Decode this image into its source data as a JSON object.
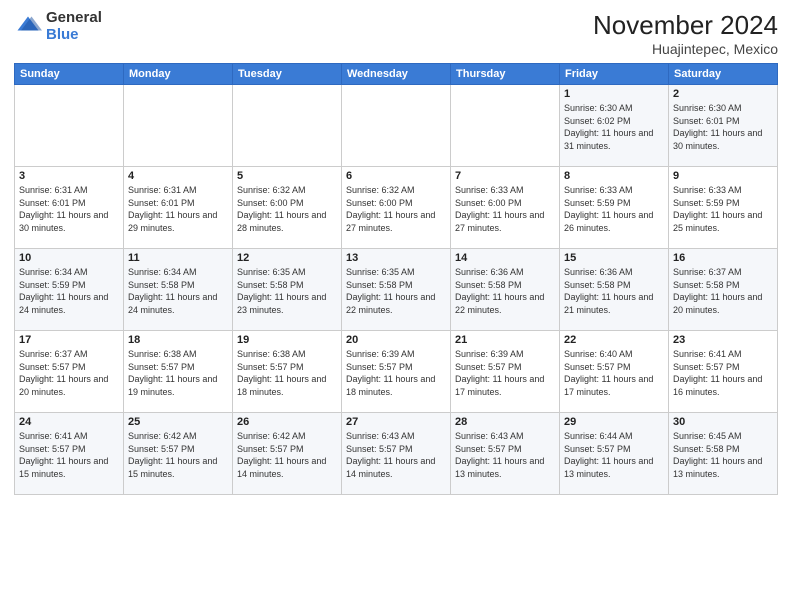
{
  "logo": {
    "general": "General",
    "blue": "Blue"
  },
  "header": {
    "month": "November 2024",
    "location": "Huajintepec, Mexico"
  },
  "days_of_week": [
    "Sunday",
    "Monday",
    "Tuesday",
    "Wednesday",
    "Thursday",
    "Friday",
    "Saturday"
  ],
  "weeks": [
    [
      {
        "day": "",
        "info": ""
      },
      {
        "day": "",
        "info": ""
      },
      {
        "day": "",
        "info": ""
      },
      {
        "day": "",
        "info": ""
      },
      {
        "day": "",
        "info": ""
      },
      {
        "day": "1",
        "info": "Sunrise: 6:30 AM\nSunset: 6:02 PM\nDaylight: 11 hours and 31 minutes."
      },
      {
        "day": "2",
        "info": "Sunrise: 6:30 AM\nSunset: 6:01 PM\nDaylight: 11 hours and 30 minutes."
      }
    ],
    [
      {
        "day": "3",
        "info": "Sunrise: 6:31 AM\nSunset: 6:01 PM\nDaylight: 11 hours and 30 minutes."
      },
      {
        "day": "4",
        "info": "Sunrise: 6:31 AM\nSunset: 6:01 PM\nDaylight: 11 hours and 29 minutes."
      },
      {
        "day": "5",
        "info": "Sunrise: 6:32 AM\nSunset: 6:00 PM\nDaylight: 11 hours and 28 minutes."
      },
      {
        "day": "6",
        "info": "Sunrise: 6:32 AM\nSunset: 6:00 PM\nDaylight: 11 hours and 27 minutes."
      },
      {
        "day": "7",
        "info": "Sunrise: 6:33 AM\nSunset: 6:00 PM\nDaylight: 11 hours and 27 minutes."
      },
      {
        "day": "8",
        "info": "Sunrise: 6:33 AM\nSunset: 5:59 PM\nDaylight: 11 hours and 26 minutes."
      },
      {
        "day": "9",
        "info": "Sunrise: 6:33 AM\nSunset: 5:59 PM\nDaylight: 11 hours and 25 minutes."
      }
    ],
    [
      {
        "day": "10",
        "info": "Sunrise: 6:34 AM\nSunset: 5:59 PM\nDaylight: 11 hours and 24 minutes."
      },
      {
        "day": "11",
        "info": "Sunrise: 6:34 AM\nSunset: 5:58 PM\nDaylight: 11 hours and 24 minutes."
      },
      {
        "day": "12",
        "info": "Sunrise: 6:35 AM\nSunset: 5:58 PM\nDaylight: 11 hours and 23 minutes."
      },
      {
        "day": "13",
        "info": "Sunrise: 6:35 AM\nSunset: 5:58 PM\nDaylight: 11 hours and 22 minutes."
      },
      {
        "day": "14",
        "info": "Sunrise: 6:36 AM\nSunset: 5:58 PM\nDaylight: 11 hours and 22 minutes."
      },
      {
        "day": "15",
        "info": "Sunrise: 6:36 AM\nSunset: 5:58 PM\nDaylight: 11 hours and 21 minutes."
      },
      {
        "day": "16",
        "info": "Sunrise: 6:37 AM\nSunset: 5:58 PM\nDaylight: 11 hours and 20 minutes."
      }
    ],
    [
      {
        "day": "17",
        "info": "Sunrise: 6:37 AM\nSunset: 5:57 PM\nDaylight: 11 hours and 20 minutes."
      },
      {
        "day": "18",
        "info": "Sunrise: 6:38 AM\nSunset: 5:57 PM\nDaylight: 11 hours and 19 minutes."
      },
      {
        "day": "19",
        "info": "Sunrise: 6:38 AM\nSunset: 5:57 PM\nDaylight: 11 hours and 18 minutes."
      },
      {
        "day": "20",
        "info": "Sunrise: 6:39 AM\nSunset: 5:57 PM\nDaylight: 11 hours and 18 minutes."
      },
      {
        "day": "21",
        "info": "Sunrise: 6:39 AM\nSunset: 5:57 PM\nDaylight: 11 hours and 17 minutes."
      },
      {
        "day": "22",
        "info": "Sunrise: 6:40 AM\nSunset: 5:57 PM\nDaylight: 11 hours and 17 minutes."
      },
      {
        "day": "23",
        "info": "Sunrise: 6:41 AM\nSunset: 5:57 PM\nDaylight: 11 hours and 16 minutes."
      }
    ],
    [
      {
        "day": "24",
        "info": "Sunrise: 6:41 AM\nSunset: 5:57 PM\nDaylight: 11 hours and 15 minutes."
      },
      {
        "day": "25",
        "info": "Sunrise: 6:42 AM\nSunset: 5:57 PM\nDaylight: 11 hours and 15 minutes."
      },
      {
        "day": "26",
        "info": "Sunrise: 6:42 AM\nSunset: 5:57 PM\nDaylight: 11 hours and 14 minutes."
      },
      {
        "day": "27",
        "info": "Sunrise: 6:43 AM\nSunset: 5:57 PM\nDaylight: 11 hours and 14 minutes."
      },
      {
        "day": "28",
        "info": "Sunrise: 6:43 AM\nSunset: 5:57 PM\nDaylight: 11 hours and 13 minutes."
      },
      {
        "day": "29",
        "info": "Sunrise: 6:44 AM\nSunset: 5:57 PM\nDaylight: 11 hours and 13 minutes."
      },
      {
        "day": "30",
        "info": "Sunrise: 6:45 AM\nSunset: 5:58 PM\nDaylight: 11 hours and 13 minutes."
      }
    ]
  ]
}
